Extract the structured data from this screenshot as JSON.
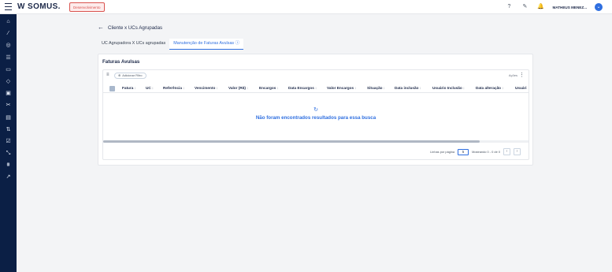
{
  "topbar": {
    "logo": "W SOMUS.",
    "env_badge": "Desenvolvimento",
    "icons": [
      "help-icon",
      "notes-icon",
      "bell-icon"
    ],
    "help_glyph": "?",
    "notes_glyph": "✎",
    "bell_glyph": "🔔",
    "username": "MATHEUS MENEZ...",
    "avatar_glyph": "⌄"
  },
  "sidebar": {
    "icons": [
      {
        "name": "home-icon",
        "glyph": "⌂"
      },
      {
        "name": "wand-icon",
        "glyph": "⁄"
      },
      {
        "name": "globe-icon",
        "glyph": "◎"
      },
      {
        "name": "grid-icon",
        "glyph": "☰"
      },
      {
        "name": "card-icon",
        "glyph": "▭"
      },
      {
        "name": "diamond-icon",
        "glyph": "◇"
      },
      {
        "name": "bill-icon",
        "glyph": "▣"
      },
      {
        "name": "tools-icon",
        "glyph": "✂"
      },
      {
        "name": "money-icon",
        "glyph": "▤"
      },
      {
        "name": "sort-list-icon",
        "glyph": "⇅"
      },
      {
        "name": "checklist-icon",
        "glyph": "☑"
      },
      {
        "name": "swap-icon",
        "glyph": "⤡"
      },
      {
        "name": "filter-icon",
        "glyph": "⩩"
      },
      {
        "name": "trend-icon",
        "glyph": "↗"
      }
    ]
  },
  "breadcrumb": {
    "back_glyph": "←",
    "title": "Cliente x UCs Agrupadas"
  },
  "tabs": [
    {
      "label": "UC Agrupadora X UCs agrupadas",
      "active": false
    },
    {
      "label": "Manutenção de Faturas Avulsas ⓘ",
      "active": true
    }
  ],
  "card": {
    "title": "Faturas Avulsas",
    "filter_icon": "≡",
    "add_filter_label": "Adicionar Filtro",
    "add_filter_plus": "⊕",
    "actions_label": "Ações",
    "kebab_glyph": "⋮",
    "columns": [
      "Fatura",
      "UC",
      "Referência",
      "Vencimento",
      "Valor (R$)",
      "Encargos",
      "Data Encargos",
      "Valor Encargos",
      "Situação",
      "Data inclusão",
      "Usuário Inclusão",
      "Data alteração",
      "Usuári"
    ],
    "sort_glyph": "↕",
    "empty_icon": "↻",
    "empty_message": "Não foram encontrados resultados para essa busca",
    "pagination": {
      "rows_label": "Linhas por página",
      "rows_value": "5",
      "showing": "Mostrando 0 - 0 de 0",
      "prev_glyph": "‹",
      "next_glyph": "›"
    }
  }
}
